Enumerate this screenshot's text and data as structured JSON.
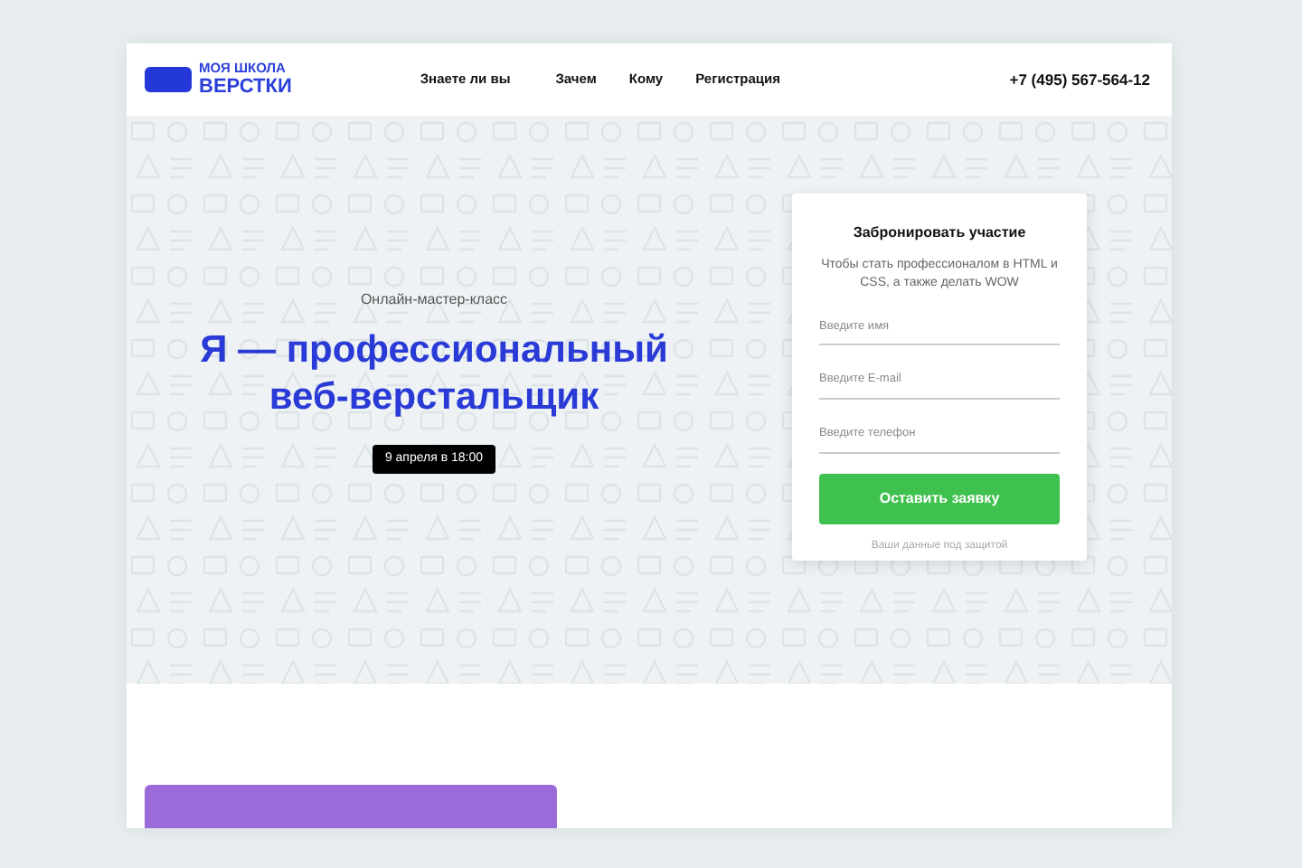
{
  "logo": {
    "line_1": "МОЯ ШКОЛА",
    "line_2": "ВЕРСТКИ"
  },
  "nav": [
    {
      "label": "Знаете ли вы"
    },
    {
      "label": "Зачем"
    },
    {
      "label": "Кому"
    },
    {
      "label": "Регистрация"
    }
  ],
  "phone": "+7 (495) 567-564-12",
  "hero": {
    "subtitle": "Онлайн-мастер-класс",
    "title": "Я — профессиональный веб-верстальщик",
    "date": "9 апреля в 18:00"
  },
  "form": {
    "title": "Забронировать участие",
    "description": "Чтобы стать профессионалом в HTML и CSS, а также делать WOW",
    "fields": [
      {
        "placeholder": "Введите имя"
      },
      {
        "placeholder": "Введите E-mail"
      },
      {
        "placeholder": "Введите телефон"
      }
    ],
    "button": "Оставить заявку",
    "note": "Ваши данные под защитой"
  }
}
